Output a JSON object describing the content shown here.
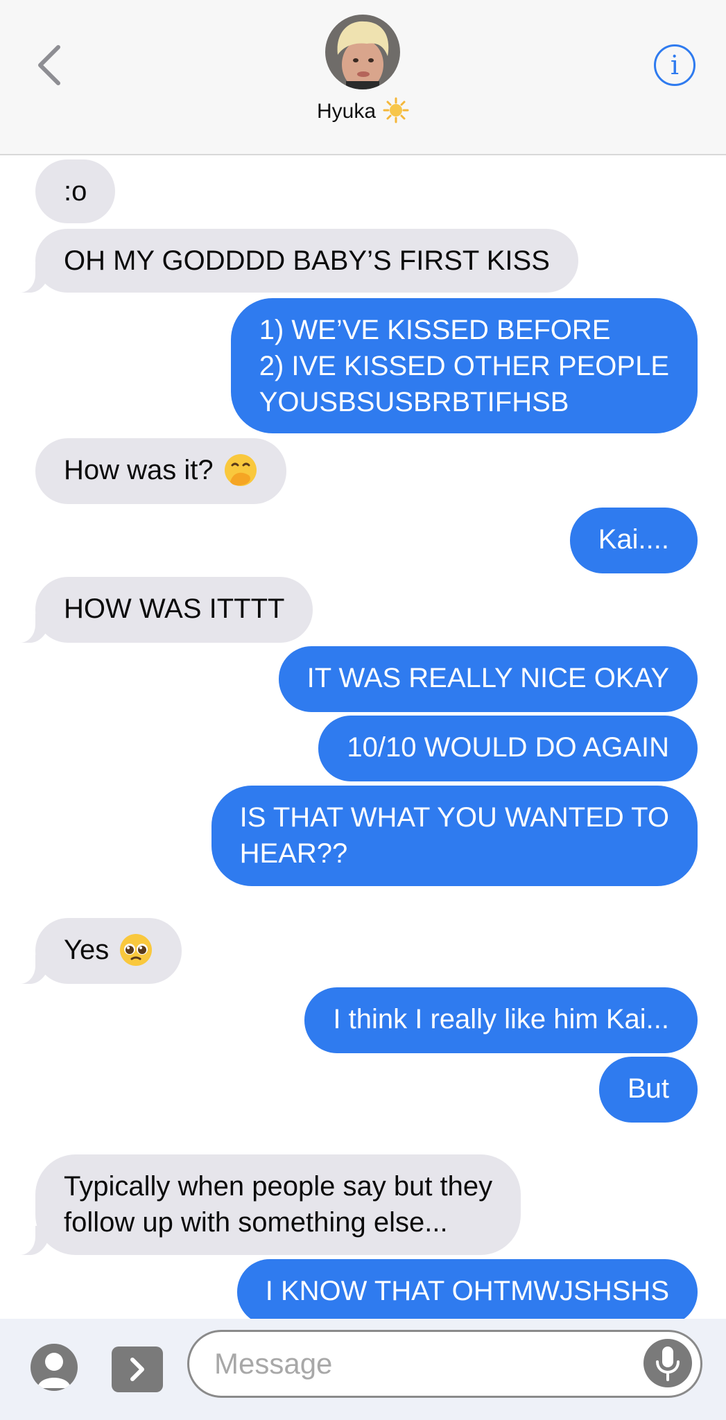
{
  "header": {
    "contact_name": "Hyuka",
    "back_icon": "chevron-left-icon",
    "info_icon": "info-icon",
    "info_glyph": "i",
    "status_emoji": "sun-icon"
  },
  "messages": [
    {
      "from": "them",
      "text": ":o"
    },
    {
      "from": "them",
      "text": "OH MY GODDDD BABY’S FIRST KISS"
    },
    {
      "from": "me",
      "lines": [
        "1) WE’VE KISSED BEFORE",
        "2) IVE KISSED OTHER PEOPLE",
        "YOUSBSUSBRBTIFHSB"
      ]
    },
    {
      "from": "them",
      "text": "How was it?",
      "emoji": "hand-over-mouth-emoji"
    },
    {
      "from": "me",
      "text": "Kai...."
    },
    {
      "from": "them",
      "text": "HOW WAS ITTTT"
    },
    {
      "from": "me",
      "text": "IT WAS REALLY NICE OKAY"
    },
    {
      "from": "me",
      "text": "10/10 WOULD DO AGAIN"
    },
    {
      "from": "me",
      "lines": [
        "IS THAT WHAT YOU WANTED TO",
        "HEAR??"
      ]
    },
    {
      "from": "them",
      "text": "Yes",
      "emoji": "pleading-face-emoji"
    },
    {
      "from": "me",
      "text": "I think I really like him Kai..."
    },
    {
      "from": "me",
      "text": "But"
    },
    {
      "from": "them",
      "lines": [
        "Typically when people say but they",
        "follow up with something else..."
      ]
    },
    {
      "from": "me",
      "text": "I KNOW THAT OHTMWJSHSHS"
    }
  ],
  "input": {
    "placeholder": "Message",
    "contact_icon": "person-icon",
    "apps_icon": "chevron-right-icon",
    "mic_icon": "microphone-icon"
  },
  "colors": {
    "outgoing": "#2f7bef",
    "incoming": "#e6e5eb",
    "accent": "#2f7bef"
  }
}
